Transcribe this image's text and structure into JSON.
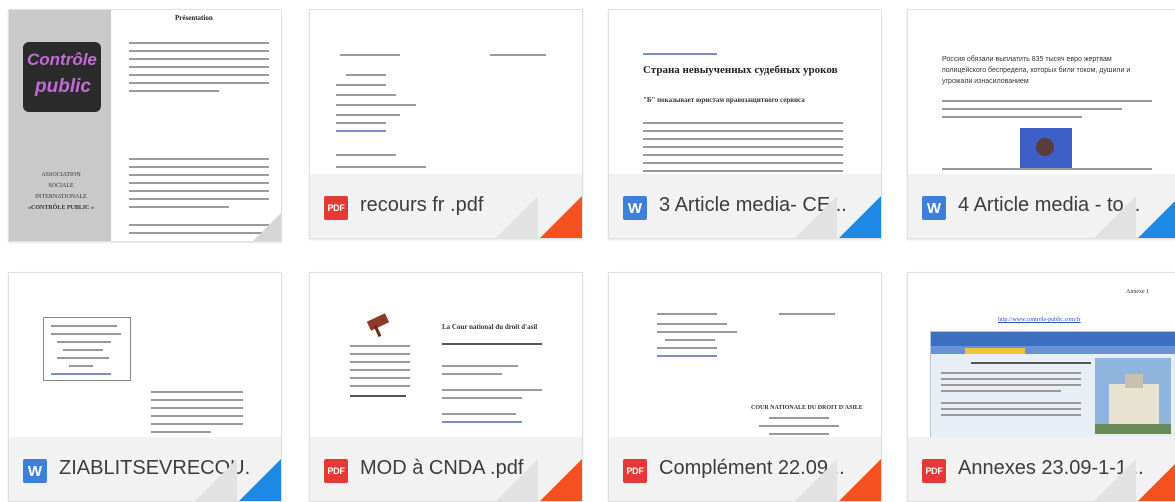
{
  "files": [
    {
      "name": "recours fr .pdf",
      "type": "pdf",
      "icon": "pdf-icon",
      "icon_label": "PDF"
    },
    {
      "name": "3 Article media- CE...",
      "type": "word",
      "icon": "word-icon",
      "icon_label": "W"
    },
    {
      "name": "4 Article media - to...",
      "type": "word",
      "icon": "word-icon",
      "icon_label": "W"
    },
    {
      "name": "ZIABLITSEVRECOU...",
      "type": "word",
      "icon": "word-icon",
      "icon_label": "W"
    },
    {
      "name": "MOD à CNDA .pdf",
      "type": "pdf",
      "icon": "pdf-icon",
      "icon_label": "PDF"
    },
    {
      "name": "Complément 22.09...",
      "type": "pdf",
      "icon": "pdf-icon",
      "icon_label": "PDF"
    },
    {
      "name": "Annexes 23.09-1-1...",
      "type": "pdf",
      "icon": "pdf-icon",
      "icon_label": "PDF"
    }
  ],
  "first_card": {
    "logo_line1": "Contrôle",
    "logo_line2": "public",
    "association_lines": [
      "ASSOCIATION",
      "SOCIALE",
      "INTERNATIONALE",
      "«CONTRÔLE PUBLIC »"
    ],
    "heading": "Présentation"
  },
  "previews": {
    "article3_title": "Страна невыученных судебных уроков",
    "article3_subtitle": "\"Б\" показывает юристам правозащитного сервиса",
    "article4_title": "Россия обязали выплатить 835 тысяч евро жертвам полицейского беспредела, которых били током, душили и угрожали изнасилованием",
    "mod_heading": "La Cour national du droit d'asil",
    "cnda_heading": "COUR NATIONALE DU DROIT D'ASILE",
    "annexes_page": "Annexe 1",
    "annexes_link": "http://www.controle-public.com/fr"
  },
  "colors": {
    "pdf": "#e53935",
    "word": "#3f7fdc",
    "pdf_corner": "#f4511e",
    "word_corner": "#1e88e5"
  }
}
